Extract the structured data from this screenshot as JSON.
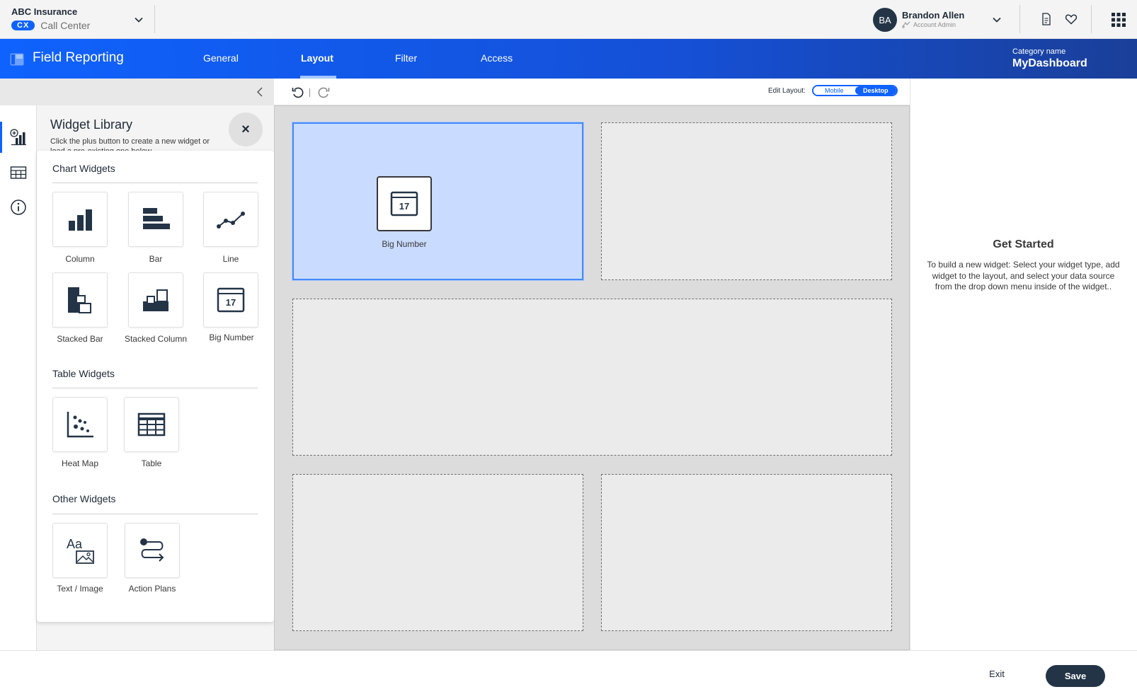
{
  "org": {
    "name": "ABC Insurance",
    "badge": "CX",
    "subtitle": "Call Center"
  },
  "user": {
    "initials": "BA",
    "name": "Brandon Allen",
    "role": "Account Admin"
  },
  "app": {
    "title": "Field Reporting"
  },
  "tabs": [
    {
      "label": "General"
    },
    {
      "label": "Layout",
      "active": true
    },
    {
      "label": "Filter"
    },
    {
      "label": "Access"
    }
  ],
  "category": {
    "label": "Category name",
    "value": "MyDashboard"
  },
  "library": {
    "title": "Widget Library",
    "description": "Click the plus button to create a new widget or load a pre-existing one below.",
    "close": "×",
    "sections": {
      "chart": {
        "title": "Chart Widgets",
        "items": [
          {
            "label": "Column",
            "icon": "column-chart-icon"
          },
          {
            "label": "Bar",
            "icon": "bar-chart-icon"
          },
          {
            "label": "Line",
            "icon": "line-chart-icon"
          },
          {
            "label": "Stacked Bar",
            "icon": "stacked-bar-icon"
          },
          {
            "label": "Stacked Column",
            "icon": "stacked-column-icon"
          },
          {
            "label": "Big Number",
            "icon": "big-number-icon",
            "number": "17"
          }
        ]
      },
      "table": {
        "title": "Table Widgets",
        "items": [
          {
            "label": "Heat Map",
            "icon": "heat-map-icon"
          },
          {
            "label": "Table",
            "icon": "table-icon"
          }
        ]
      },
      "other": {
        "title": "Other Widgets",
        "items": [
          {
            "label": "Text / Image",
            "icon": "text-image-icon",
            "glyph": "Aa"
          },
          {
            "label": "Action Plans",
            "icon": "action-plans-icon"
          }
        ]
      }
    }
  },
  "editor": {
    "edit_layout_label": "Edit Layout:",
    "modes": [
      "Mobile",
      "Desktop"
    ],
    "active_mode": "Desktop"
  },
  "canvas": {
    "placed_widget": {
      "label": "Big Number",
      "number": "17"
    }
  },
  "get_started": {
    "title": "Get Started",
    "body": "To build a new widget: Select your widget type, add widget to the layout, and select your data source from the drop down menu inside of the widget.."
  },
  "footer": {
    "exit": "Exit",
    "save": "Save"
  },
  "colors": {
    "brand_blue": "#0f62fe",
    "navy": "#243447",
    "selection": "#c9dbff"
  }
}
